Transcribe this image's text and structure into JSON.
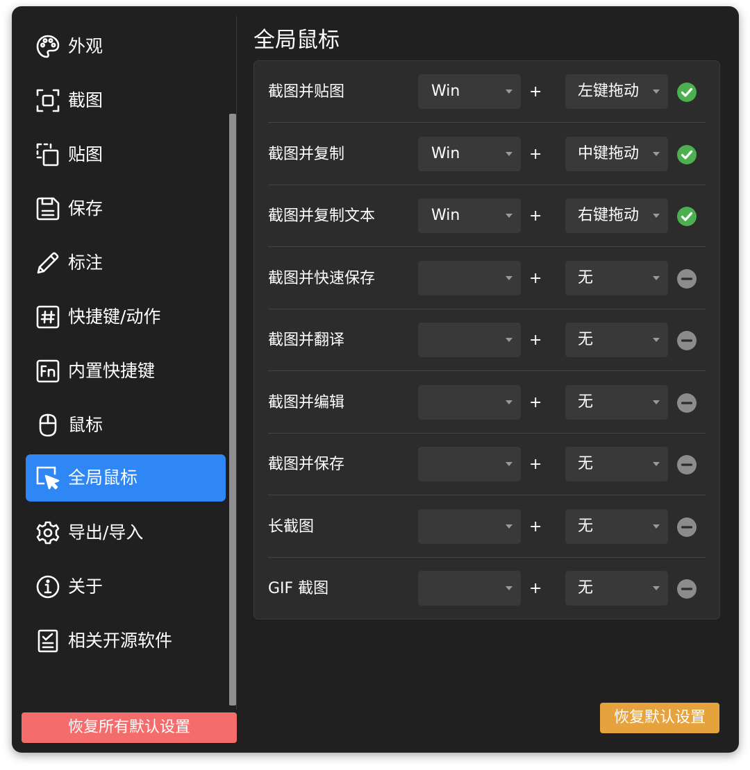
{
  "sidebar": {
    "items": [
      {
        "label": "外观",
        "icon": "palette-icon",
        "active": false
      },
      {
        "label": "截图",
        "icon": "screenshot-icon",
        "active": false
      },
      {
        "label": "贴图",
        "icon": "pin-image-icon",
        "active": false
      },
      {
        "label": "保存",
        "icon": "save-icon",
        "active": false
      },
      {
        "label": "标注",
        "icon": "pencil-icon",
        "active": false
      },
      {
        "label": "快捷键/动作",
        "icon": "hash-icon",
        "active": false
      },
      {
        "label": "内置快捷键",
        "icon": "fn-key-icon",
        "active": false
      },
      {
        "label": "鼠标",
        "icon": "mouse-icon",
        "active": false
      },
      {
        "label": "全局鼠标",
        "icon": "cursor-select-icon",
        "active": true
      },
      {
        "label": "导出/导入",
        "icon": "gear-icon",
        "active": false
      },
      {
        "label": "关于",
        "icon": "info-icon",
        "active": false
      },
      {
        "label": "相关开源软件",
        "icon": "checklist-icon",
        "active": false
      }
    ],
    "reset_all_label": "恢复所有默认设置"
  },
  "main": {
    "title": "全局鼠标",
    "plus": "+",
    "rows": [
      {
        "label": "截图并贴图",
        "modifier": "Win",
        "button": "左键拖动",
        "status": "enabled"
      },
      {
        "label": "截图并复制",
        "modifier": "Win",
        "button": "中键拖动",
        "status": "enabled"
      },
      {
        "label": "截图并复制文本",
        "modifier": "Win",
        "button": "右键拖动",
        "status": "enabled"
      },
      {
        "label": "截图并快速保存",
        "modifier": "",
        "button": "无",
        "status": "disabled"
      },
      {
        "label": "截图并翻译",
        "modifier": "",
        "button": "无",
        "status": "disabled"
      },
      {
        "label": "截图并编辑",
        "modifier": "",
        "button": "无",
        "status": "disabled"
      },
      {
        "label": "截图并保存",
        "modifier": "",
        "button": "无",
        "status": "disabled"
      },
      {
        "label": "长截图",
        "modifier": "",
        "button": "无",
        "status": "disabled"
      },
      {
        "label": "GIF 截图",
        "modifier": "",
        "button": "无",
        "status": "disabled"
      }
    ],
    "restore_label": "恢复默认设置"
  },
  "colors": {
    "active": "#2f87f5",
    "enabled": "#4caf50",
    "disabled": "#8c8c8c",
    "reset_all": "#f56c6c",
    "restore": "#e6a23c"
  }
}
